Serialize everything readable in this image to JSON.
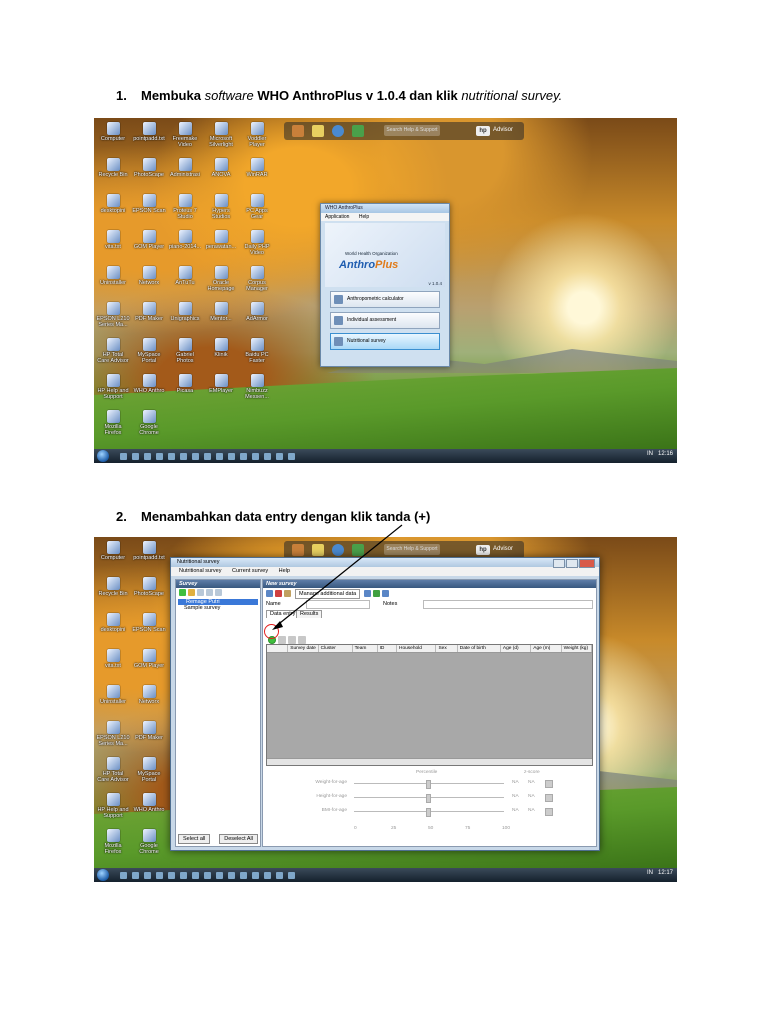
{
  "step1": {
    "num": "1.",
    "part1": "Membuka",
    "part2": "software",
    "part3": "WHO AnthroPlus v 1.0.4 dan klik",
    "part4": "nutritional survey."
  },
  "step2": {
    "num": "2.",
    "text": "Menambahkan data entry dengan klik tanda (+)"
  },
  "desktop": {
    "toolbar_search": "Search Help & Support",
    "toolbar_brand": "hp",
    "toolbar_advisor": "Advisor",
    "icons": [
      "Computer",
      "pointpadd.txt",
      "Freemake Video",
      "Microsoft Silverlight",
      "Voddler Player",
      "Recycle Bin",
      "PhotoScape",
      "Administrasi",
      "ANOVA",
      "WinRAR",
      "desktopini",
      "EPSON Scan",
      "Proteus 7 Studio",
      "Hypers Studios",
      "PC Apps Gear",
      "vita.txt",
      "GOM Player",
      "piano-2014...",
      "perawatan...",
      "Daily PHP Video",
      "Uninstaller",
      "Networx",
      "AnTuTu",
      "Oracle Homepage",
      "Corpus Manager",
      "EPSON L210 Series Ma...",
      "PDF Maker",
      "Unigraphics",
      "Mentor...",
      "AdArmor",
      "HP Total Care Advisor",
      "MySpace Portal",
      "Gabriel Photos",
      "Klinik",
      "Baidu PC Faster",
      "HP Help and Support",
      "WHO Anthro",
      "Picasa",
      "EMPlayer",
      "Nimbuzz Messen...",
      "Mozilla Firefox",
      "Google Chrome"
    ],
    "tray_lang": "IN",
    "clock1": "12:16",
    "clock2": "12:17"
  },
  "anthro_window": {
    "title": "WHO AnthroPlus",
    "menu": [
      "Application",
      "Help"
    ],
    "logo_org": "World Health Organization",
    "logo_word_a": "Anthro",
    "logo_word_b": "Plus",
    "version": "v 1.0.4",
    "buttons": [
      "Anthropometric calculator",
      "Individual assessment",
      "Nutritional survey"
    ]
  },
  "survey_window": {
    "title": "Nutritional survey",
    "menu": [
      "Nutritional survey",
      "Current survey",
      "Help"
    ],
    "left_header": "Survey",
    "surveys": [
      "Remage Putri",
      "Sample survey"
    ],
    "select_all": "Select all",
    "deselect_all": "Deselect All",
    "right_header": "New survey",
    "manage": "Manage additional data",
    "name_label": "Name",
    "notes_label": "Notes",
    "tabs": [
      "Data entry",
      "Results"
    ],
    "columns": [
      "Survey date",
      "Cluster",
      "Team",
      "ID",
      "Household",
      "Sex",
      "Date of birth",
      "Age (d)",
      "Age (m)",
      "Weight (kg)"
    ],
    "zone": {
      "percentile": "Percentile",
      "zscore": "z-score",
      "rows": [
        "Weight-for-age",
        "Height-for-age",
        "BMI-for-age"
      ],
      "na": "NA",
      "ticks": [
        "0",
        "25",
        "50",
        "75",
        "100"
      ]
    }
  }
}
